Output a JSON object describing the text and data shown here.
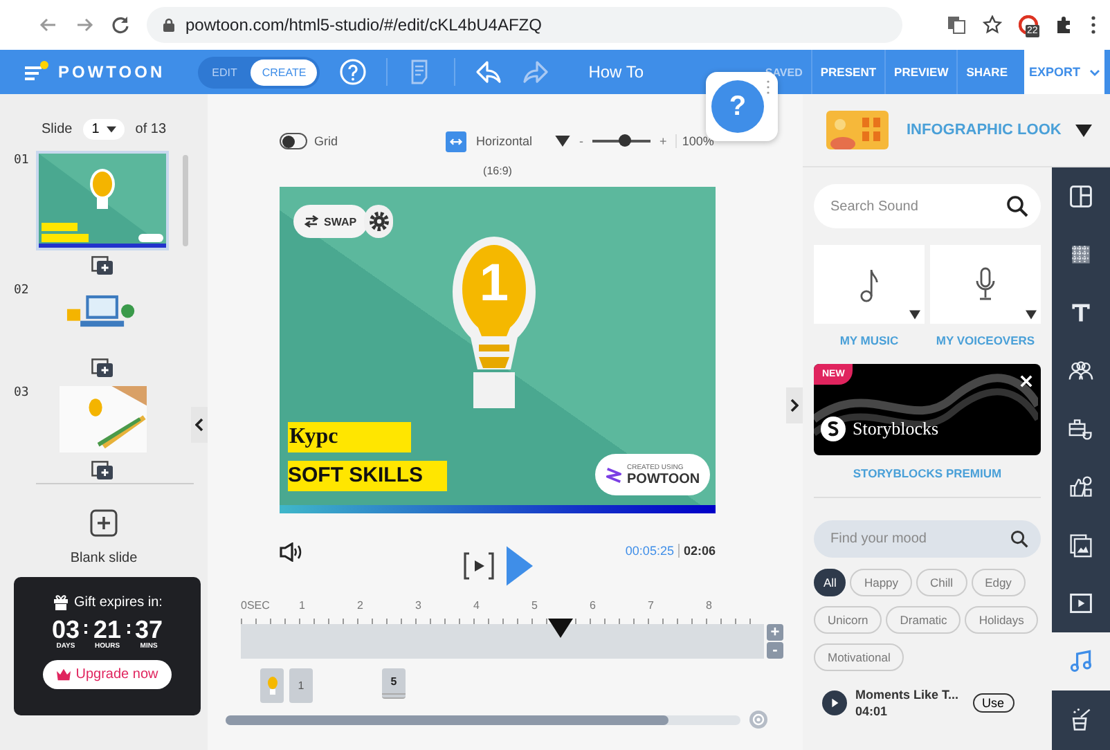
{
  "browser": {
    "url": "powtoon.com/html5-studio/#/edit/cKL4bU4AFZQ",
    "extension_badge": "22"
  },
  "header": {
    "logo": "POWTOON",
    "modes": [
      {
        "label": "EDIT",
        "selected": false
      },
      {
        "label": "CREATE",
        "selected": true
      }
    ],
    "project_title": "How To",
    "save_status": "SAVED",
    "actions": [
      "PRESENT",
      "PREVIEW",
      "SHARE"
    ],
    "export": "EXPORT"
  },
  "help_button": "?",
  "slides_panel": {
    "label": "Slide",
    "current": "1",
    "total": "of 13",
    "blank_slide": "Blank slide",
    "slides": [
      {
        "number": "01",
        "selected": true
      },
      {
        "number": "02",
        "selected": false
      },
      {
        "number": "03",
        "selected": false
      }
    ]
  },
  "gift": {
    "title": "Gift expires in:",
    "button": "Upgrade now",
    "units": [
      {
        "value": "03",
        "label": "DAYS"
      },
      {
        "value": "21",
        "label": "HOURS"
      },
      {
        "value": "37",
        "label": "MINS"
      }
    ]
  },
  "canvas_toolbar": {
    "grid_label": "Grid",
    "grid_on": false,
    "orientation": "Horizontal",
    "minus": "-",
    "plus": "+",
    "zoom": {
      "level": 0.55,
      "reading": "100%"
    },
    "aspect": "(16:9)"
  },
  "slide": {
    "swap": "SWAP",
    "bulb_number": "1",
    "title_line": "Курс",
    "subtitle": "SOFT SKILLS",
    "badge_caption": "CREATED USING",
    "badge_brand": "POWTOON"
  },
  "playback": {
    "current_time": "00:05:25",
    "duration": "02:06"
  },
  "timeline": {
    "ruler": [
      "0SEC",
      "1",
      "2",
      "3",
      "4",
      "5",
      "6",
      "7",
      "8"
    ],
    "playhead": {
      "level": 0.61
    },
    "zoom_in": "+",
    "zoom_out": "-",
    "markers": [
      {
        "kind": "bulb"
      },
      {
        "kind": "number",
        "label": "1"
      },
      {
        "kind": "number",
        "label": "5"
      }
    ],
    "scroll": {
      "level": 0.86
    }
  },
  "look": {
    "title": "INFOGRAPHIC LOOK"
  },
  "sound_search": {
    "placeholder": "Search Sound"
  },
  "libraries": [
    {
      "kind": "music",
      "label": "MY MUSIC"
    },
    {
      "kind": "voice",
      "label": "MY VOICEOVERS"
    }
  ],
  "promo": {
    "badge": "NEW",
    "brand": "Storyblocks",
    "caption": "STORYBLOCKS PREMIUM"
  },
  "mood_search": {
    "placeholder": "Find your mood"
  },
  "moods": [
    {
      "label": "All",
      "selected": true
    },
    {
      "label": "Happy",
      "selected": false
    },
    {
      "label": "Chill",
      "selected": false
    },
    {
      "label": "Edgy",
      "selected": false
    },
    {
      "label": "Unicorn",
      "selected": false
    },
    {
      "label": "Dramatic",
      "selected": false
    },
    {
      "label": "Holidays",
      "selected": false
    },
    {
      "label": "Motivational",
      "selected": false
    }
  ],
  "track": {
    "title": "Moments Like T...",
    "duration": "04:01",
    "button": "Use"
  },
  "rail": [
    {
      "kind": "layout",
      "selected": false
    },
    {
      "kind": "pattern",
      "selected": false
    },
    {
      "kind": "text",
      "selected": false
    },
    {
      "kind": "people",
      "selected": false
    },
    {
      "kind": "props",
      "selected": false
    },
    {
      "kind": "shapes",
      "selected": false
    },
    {
      "kind": "images",
      "selected": false
    },
    {
      "kind": "video",
      "selected": false
    },
    {
      "kind": "music",
      "selected": true
    },
    {
      "kind": "magic",
      "selected": false
    }
  ]
}
